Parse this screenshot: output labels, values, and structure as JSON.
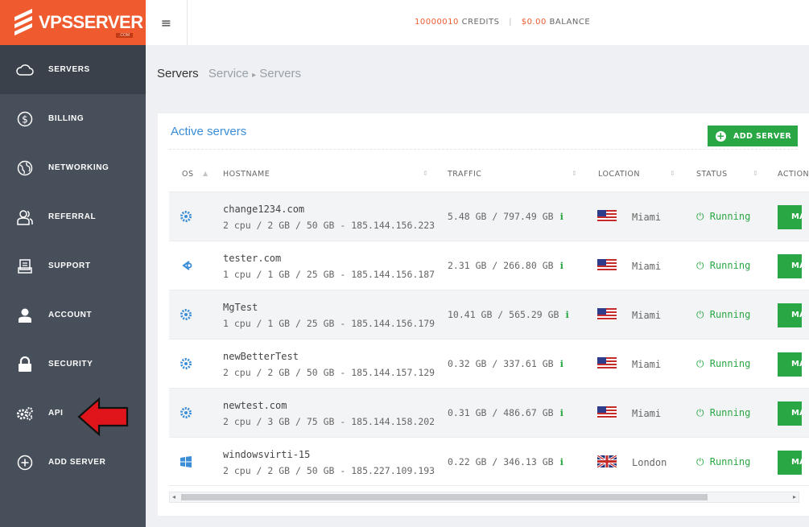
{
  "brand": {
    "name": "VPSSERVER",
    "sub": ".COM"
  },
  "sidebar": {
    "items": [
      {
        "label": "SERVERS",
        "icon": "cloud-icon",
        "active": true
      },
      {
        "label": "BILLING",
        "icon": "dollar-circle-icon"
      },
      {
        "label": "NETWORKING",
        "icon": "globe-icon"
      },
      {
        "label": "REFERRAL",
        "icon": "users-icon"
      },
      {
        "label": "SUPPORT",
        "icon": "support-document-icon"
      },
      {
        "label": "ACCOUNT",
        "icon": "user-icon"
      },
      {
        "label": "SECURITY",
        "icon": "lock-icon"
      },
      {
        "label": "API",
        "icon": "gears-icon"
      },
      {
        "label": "ADD SERVER",
        "icon": "plus-circle-icon"
      }
    ]
  },
  "topbar": {
    "credits_value": "10000010",
    "credits_label": "CREDITS",
    "separator": "|",
    "balance_value": "$0.00",
    "balance_label": "BALANCE"
  },
  "breadcrumb": {
    "title": "Servers",
    "crumb1": "Service",
    "arrow": "▸",
    "crumb2": "Servers"
  },
  "panel": {
    "title": "Active servers",
    "add_button": "ADD SERVER",
    "columns": {
      "os": "OS",
      "hostname": "HOSTNAME",
      "traffic": "TRAFFIC",
      "location": "LOCATION",
      "status": "STATUS",
      "actions": "ACTIONS"
    },
    "rows": [
      {
        "os": "gear",
        "hostname": "change1234.com",
        "spec": "2 cpu / 2 GB / 50 GB - 185.144.156.223",
        "traffic": "5.48 GB / 797.49 GB",
        "flag": "us",
        "location": "Miami",
        "status": "Running",
        "action": "MANAGE"
      },
      {
        "os": "alt",
        "hostname": "tester.com",
        "spec": "1 cpu / 1 GB / 25 GB - 185.144.156.187",
        "traffic": "2.31 GB / 266.80 GB",
        "flag": "us",
        "location": "Miami",
        "status": "Running",
        "action": "MANAGE"
      },
      {
        "os": "gear",
        "hostname": "MgTest",
        "spec": "1 cpu / 1 GB / 25 GB - 185.144.156.179",
        "traffic": "10.41 GB / 565.29 GB",
        "flag": "us",
        "location": "Miami",
        "status": "Running",
        "action": "MANAGE"
      },
      {
        "os": "gear",
        "hostname": "newBetterTest",
        "spec": "2 cpu / 2 GB / 50 GB - 185.144.157.129",
        "traffic": "0.32 GB / 337.61 GB",
        "flag": "us",
        "location": "Miami",
        "status": "Running",
        "action": "MANAGE"
      },
      {
        "os": "gear",
        "hostname": "newtest.com",
        "spec": "2 cpu / 3 GB / 75 GB - 185.144.158.202",
        "traffic": "0.31 GB / 486.67 GB",
        "flag": "us",
        "location": "Miami",
        "status": "Running",
        "action": "MANAGE"
      },
      {
        "os": "windows",
        "hostname": "windowsvirti-15",
        "spec": "2 cpu / 2 GB / 50 GB - 185.227.109.193",
        "traffic": "0.22 GB / 346.13 GB",
        "flag": "uk",
        "location": "London",
        "status": "Running",
        "action": "MANAGE"
      }
    ]
  },
  "colors": {
    "brand": "#ef5a2f",
    "sidebar": "#474f5a",
    "accent_green": "#29a744",
    "link_blue": "#3b8dd6",
    "arrow_red": "#e0151b"
  }
}
